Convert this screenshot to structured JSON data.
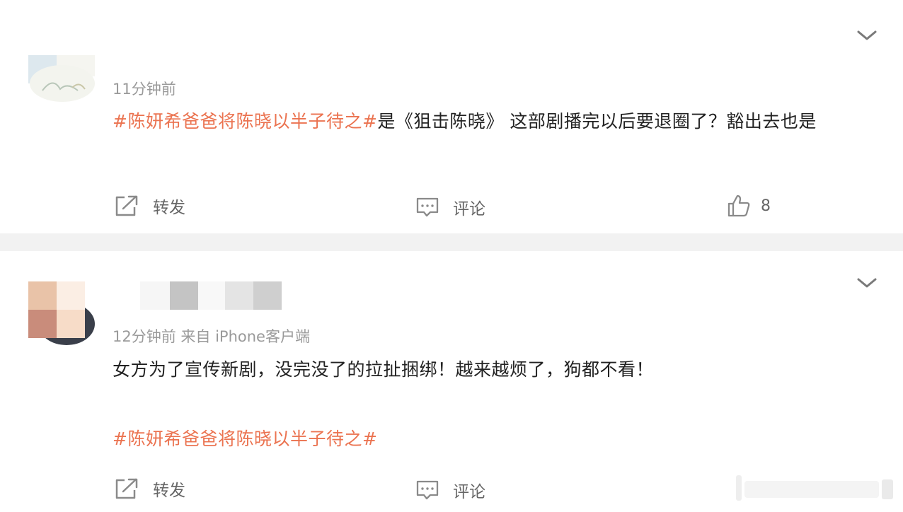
{
  "posts": [
    {
      "time_source": "11分钟前",
      "hashtag": "#陈妍希爸爸将陈晓以半子待之#",
      "text": "是《狙击陈晓》 这部剧播完以后要退圈了？豁出去也是",
      "actions": {
        "repost": "转发",
        "comment": "评论",
        "like_count": "8"
      }
    },
    {
      "time_source": "12分钟前  来自 iPhone客户端",
      "text": "女方为了宣传新剧，没完没了的拉扯捆绑！越来越烦了，狗都不看！",
      "hashtag": "#陈妍希爸爸将陈晓以半子待之#",
      "actions": {
        "repost": "转发",
        "comment": "评论"
      }
    }
  ],
  "colors": {
    "hashtag": "#eb7350",
    "text": "#222222",
    "meta": "#9a9a9a",
    "action": "#666666",
    "icon": "#8a8a8a",
    "separator": "#f2f2f2"
  },
  "icons": [
    "chevron-down-icon",
    "share-icon",
    "comment-icon",
    "thumbs-up-icon"
  ]
}
